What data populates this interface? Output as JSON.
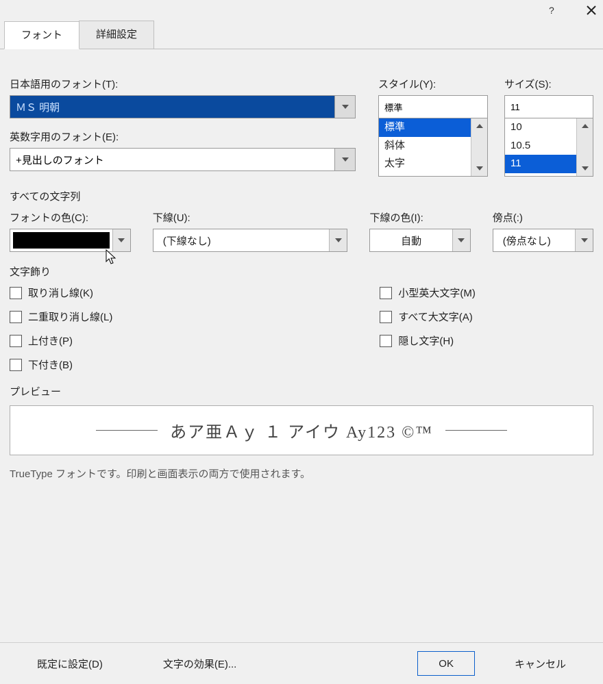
{
  "titlebar": {
    "help_icon": "?",
    "close_icon": "×"
  },
  "tabs": {
    "font": "フォント",
    "advanced": "詳細設定"
  },
  "labels": {
    "japanese_font": "日本語用のフォント(T):",
    "latin_font": "英数字用のフォント(E):",
    "style": "スタイル(Y):",
    "size": "サイズ(S):",
    "all_text": "すべての文字列",
    "font_color": "フォントの色(C):",
    "underline": "下線(U):",
    "underline_color": "下線の色(I):",
    "emphasis": "傍点(:)",
    "effects": "文字飾り",
    "preview": "プレビュー",
    "truetype_note": "TrueType フォントです。印刷と画面表示の両方で使用されます。"
  },
  "values": {
    "japanese_font": "ＭＳ 明朝",
    "latin_font": "+見出しのフォント",
    "style_input": "標準",
    "size_input": "11",
    "underline": "(下線なし)",
    "underline_color": "自動",
    "emphasis": "(傍点なし)"
  },
  "style_options": [
    "標準",
    "斜体",
    "太字"
  ],
  "size_options": [
    "10",
    "10.5",
    "11"
  ],
  "effects_left": [
    "取り消し線(K)",
    "二重取り消し線(L)",
    "上付き(P)",
    "下付き(B)"
  ],
  "effects_right": [
    "小型英大文字(M)",
    "すべて大文字(A)",
    "隠し文字(H)"
  ],
  "preview_text": "あア亜Ａｙ １ アイウ Ay123 ©™",
  "footer": {
    "set_default": "既定に設定(D)",
    "text_effects": "文字の効果(E)...",
    "ok": "OK",
    "cancel": "キャンセル"
  }
}
